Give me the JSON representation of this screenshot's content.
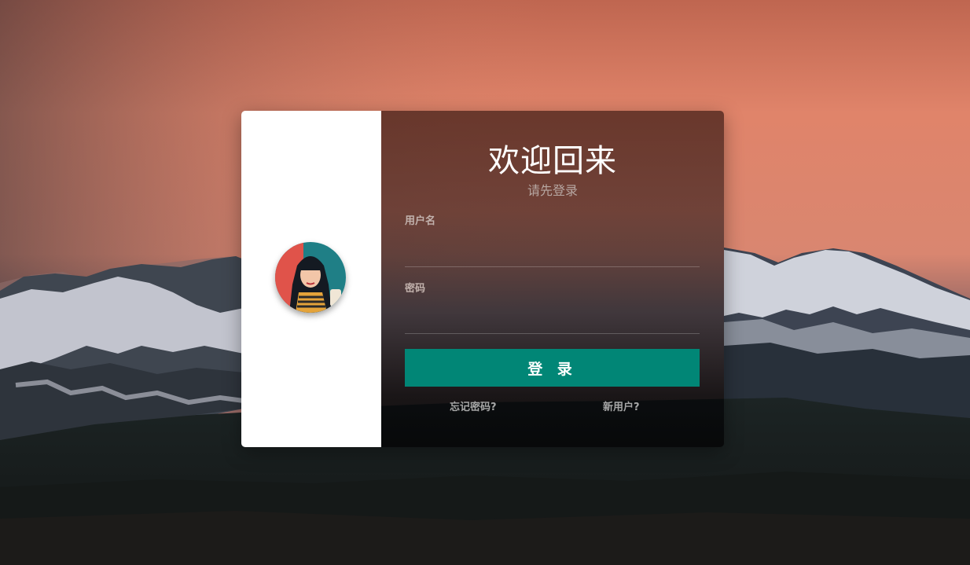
{
  "login": {
    "title": "欢迎回来",
    "subtitle": "请先登录",
    "username_label": "用户名",
    "username_value": "",
    "password_label": "密码",
    "password_value": "",
    "submit_label": "登 录",
    "forgot_link": "忘记密码?",
    "register_link": "新用户?"
  },
  "colors": {
    "button": "#018676",
    "card_left": "#ffffff"
  },
  "icons": {
    "avatar": "user-avatar-illustration"
  }
}
